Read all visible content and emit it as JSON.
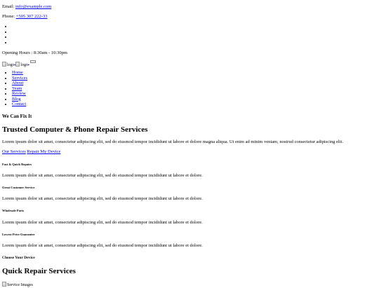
{
  "topbar": {
    "email_label": "Email:",
    "email_link": "info@example.com",
    "phone_label": "Phone:",
    "phone_link": "+505 307 222-33",
    "social_icons": [
      "social-icon",
      "social-icon",
      "social-icon",
      "social-icon"
    ],
    "opening_hours": "Opening Hours : 8:30am - 10:30pm"
  },
  "header": {
    "logo_alt_1": "logo",
    "logo_alt_2": "logo"
  },
  "nav": {
    "items": [
      "Home",
      "Services",
      "About",
      "Team",
      "Review",
      "Blog",
      "Contact"
    ]
  },
  "hero": {
    "kicker": "We Can Fix It",
    "title": "Trusted Computer & Phone Repair Services",
    "text": "Lorem ipsum dolor sit amet, consectetur adipiscing elit, sed do eiusmod tempor incididunt ut labore et dolore magna aliqua. Ut enim ad minim veniam, nostrud consectetur adipiscing elit.",
    "btn_services": "Our Services",
    "btn_repair": "Repair My Device"
  },
  "features": [
    {
      "title": "Fast & Quick Repairs",
      "text": "Lorem ipsum dolor sit amet, consectetur adipiscing elit, sed do eiusmod tempor incididunt ut labore et dolore."
    },
    {
      "title": "Great Customer Service",
      "text": "Lorem ipsum dolor sit amet, consectetur adipiscing elit, sed do eiusmod tempor incididunt ut labore et dolore."
    },
    {
      "title": "Wholesale Parts",
      "text": "Lorem ipsum dolor sit amet, consectetur adipiscing elit, sed do eiusmod tempor incididunt ut labore et dolore."
    },
    {
      "title": "Lowest Price Guarantee",
      "text": "Lorem ipsum dolor sit amet, consectetur adipiscing elit, sed do eiusmod tempor incididunt ut labore et dolore."
    }
  ],
  "devices": {
    "heading": "Choose Your Device",
    "title": "Quick Repair Services",
    "image_alt": "Service Images"
  }
}
